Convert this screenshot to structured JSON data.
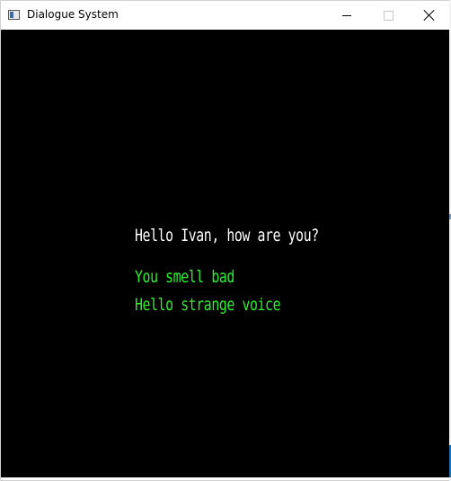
{
  "window": {
    "title": "Dialogue System",
    "app_icon": "window-app-icon",
    "controls": {
      "minimize_icon": "minimize-icon",
      "maximize_icon": "maximize-icon",
      "close_icon": "close-icon"
    }
  },
  "dialogue": {
    "prompt": "Hello Ivan, how are you?",
    "options": [
      "You smell bad",
      "Hello strange voice"
    ]
  },
  "colors": {
    "background": "#000000",
    "prompt_text": "#ffffff",
    "option_text": "#2ef02e"
  }
}
